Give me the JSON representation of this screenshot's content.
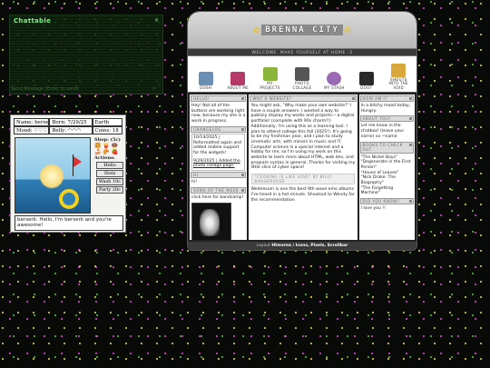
{
  "chat": {
    "title": "Chattable",
    "close": "×",
    "footer_placeholder": "Send Message (Enter to send)",
    "send": "»"
  },
  "pet": {
    "name": "Name: berserk",
    "born": "Born: 7/29/25",
    "planet": "Earth",
    "mood": "Mood: ♡♡♡",
    "belly": "Belly: ◠◠◠",
    "coins": "Coins: 18",
    "shop_label": "Shop: (5c)",
    "food": [
      "🍔",
      "🍟",
      "🍩",
      "🍰",
      "🥐",
      "🍓"
    ],
    "actions_label": "Actions:",
    "actions": [
      "Hello",
      "Slots",
      "Wash 10c",
      "Party 20c"
    ],
    "message": "berserk: Hello, I'm berserk and you're awesome!"
  },
  "site": {
    "title": "BRENNA CITY",
    "welcome": "WELCOME. MAKE YOURSELF AT HOME :3",
    "nav": [
      {
        "label": "DOSH",
        "icon": "computer-icon",
        "color": "#6a8fb5"
      },
      {
        "label": "ABOUT ME",
        "icon": "book-icon",
        "color": "#b53a6a"
      },
      {
        "label": "MY PROJECTS",
        "icon": "characters-icon",
        "color": "#8bb53a"
      },
      {
        "label": "PHOTO COLLAGE",
        "icon": "camera-icon",
        "color": "#555555"
      },
      {
        "label": "MY STASH",
        "icon": "disc-icon",
        "color": "#9a6ab5"
      },
      {
        "label": "DOOT",
        "icon": "sparkle-icon",
        "color": "#2a2a2a"
      },
      {
        "label": "SHOUTS INTO THE VOID",
        "icon": "megaphone-icon",
        "color": "#d8a83a"
      }
    ],
    "left": {
      "hello_hdr": "HELLO!",
      "hello_text": "Hey! Not all of the buttons are working right now, because my site is a work in progress.",
      "changelog_hdr": "CHANGELOG",
      "changelog_1": "10/14/2025 | Reformatted again and added mobile support for the widgets!",
      "changelog_2": "9/29/2025 | Added the photo collage page.",
      "hi_hdr": "HI",
      "hi_text": "hi!",
      "song_hdr": "SONG OF THE WEEK",
      "song_text": "click here for bandcamp!"
    },
    "middle": {
      "why_hdr": "WHY A WEBSITE?",
      "why_text": "You might ask, \"Why make your own website?\" I have a couple answers. I wanted a way to publicly display my works and projects— a digital portfolio! (complete with 90s charm!!) Additionally, I'm using this as a learning tool. I plan to attend college this fall (2025!). It's going to be my freshman year, and I plan to study cinematic arts, with minors in music and IT. Computer science is a special interest and a hobby for me, so I'm using my work on this website to learn more about HTML, web dev, and program syntax in general. Thanks for visiting my little slice of cyber space!",
      "rec_hdr": "\"COOKING IS LIKE LOVE\" BY BILLY BARGEROUSE",
      "rec_text": "Wednesum is one the best 9th wave emo albums I've heard in a hot minute. Shoutout to Wendy for the recommendation"
    },
    "right": {
      "howis_hdr": "HOW AM I?",
      "howis_text": "In a bitchy mood today, Hungry.",
      "about_hdr": "ABOUT YOU?",
      "about_text": "Let me know in the chatbox! (leave your name) xx ~name",
      "books_hdr": "BOOKS TO CHECK OUT",
      "books": [
        "\"The Nickel Boys\"",
        "\"Degenerate in the First Person\"",
        "\"House of Leaves\"",
        "\"Nick Drake: The Biography\"",
        "\"The Forgetting Machine\""
      ],
      "didyou_hdr": "DID YOU KNOW?",
      "didyou_text": "I love you !!"
    },
    "footer_prefix": "Layout",
    "footer_links": "Htmsrea / Icons, Pixels, Scrollbar"
  }
}
